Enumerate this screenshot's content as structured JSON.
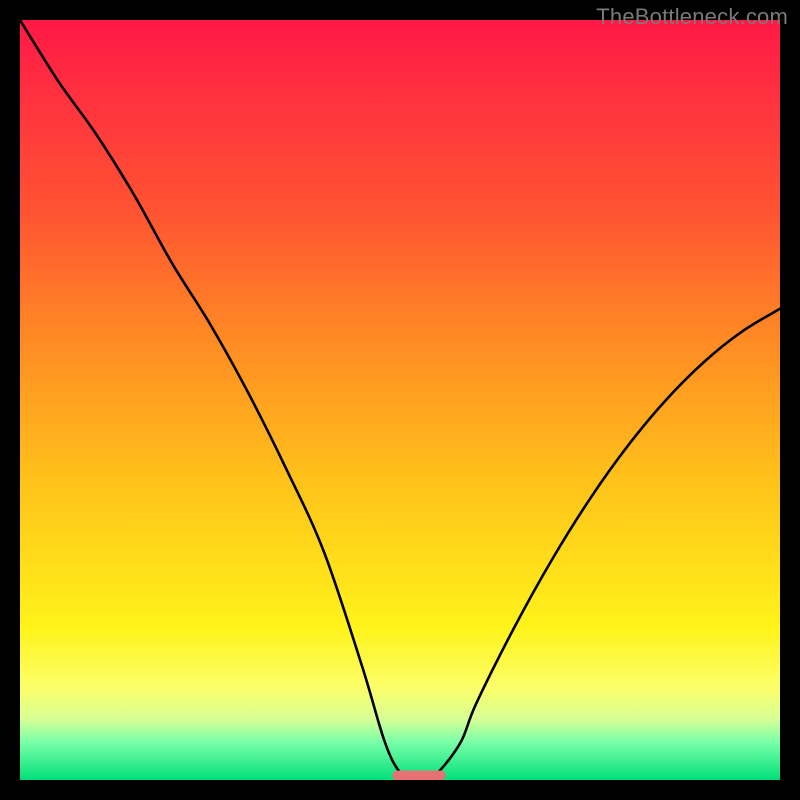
{
  "watermark": "TheBottleneck.com",
  "chart_data": {
    "type": "line",
    "title": "",
    "xlabel": "",
    "ylabel": "",
    "xlim": [
      0,
      100
    ],
    "ylim": [
      0,
      100
    ],
    "x": [
      0,
      5,
      10,
      15,
      20,
      25,
      30,
      35,
      40,
      45,
      48,
      50,
      52,
      53,
      55,
      58,
      60,
      65,
      70,
      75,
      80,
      85,
      90,
      95,
      100
    ],
    "values": [
      100,
      92,
      85,
      77,
      68,
      60,
      51,
      41,
      30,
      15,
      5,
      1,
      0,
      0,
      1,
      5,
      10,
      20,
      29,
      37,
      44,
      50,
      55,
      59,
      62
    ],
    "marker": {
      "x_range": [
        49,
        56
      ],
      "y": 0.6,
      "color": "#e57373"
    },
    "gradient_stops": [
      {
        "pct": 0,
        "color": "#ff1846"
      },
      {
        "pct": 25,
        "color": "#ff5332"
      },
      {
        "pct": 60,
        "color": "#ffc01a"
      },
      {
        "pct": 80,
        "color": "#fff31a"
      },
      {
        "pct": 95,
        "color": "#7affa8"
      },
      {
        "pct": 100,
        "color": "#00e07a"
      }
    ]
  }
}
